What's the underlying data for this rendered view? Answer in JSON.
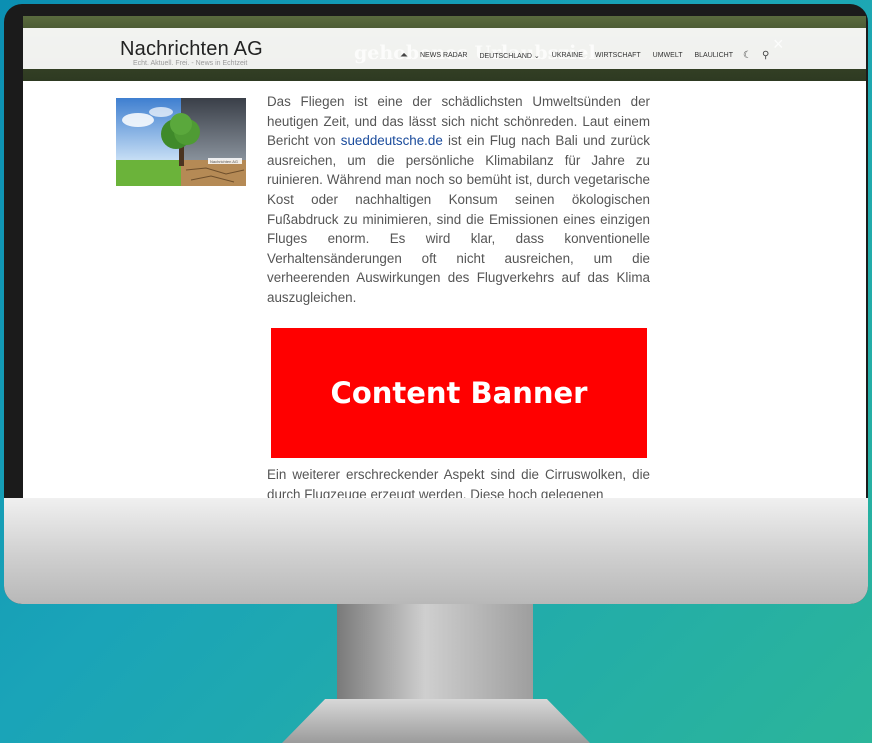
{
  "site": {
    "title": "Nachrichten AG",
    "tagline": "Echt. Aktuell. Frei. - News in Echtzeit",
    "hero_overlay": "gehobenes Urlaubsziel"
  },
  "nav": {
    "items": [
      "NEWS RADAR",
      "DEUTSCHLAND ⌄",
      "UKRAINE",
      "WIRTSCHAFT",
      "UMWELT",
      "BLAULICHT"
    ]
  },
  "thumbnail": {
    "caption": "Nachrichten AG"
  },
  "article": {
    "para1_before_link": "Das Fliegen ist eine der schädlichsten Umweltsünden der heutigen Zeit, und das lässt sich nicht schönreden. Laut einem Bericht von ",
    "link_text": "sueddeutsche.de",
    "para1_after_link": " ist ein Flug nach Bali und zurück ausreichen, um die persönliche Klimabilanz für Jahre zu ruinieren. Während man noch so bemüht ist, durch vegetarische Kost oder nachhaltigen Konsum seinen ökologischen Fußabdruck zu minimieren, sind die Emissionen eines einzigen Fluges enorm. Es wird klar, dass konventionelle Verhaltensänderungen oft nicht ausreichen, um die verheerenden Auswirkungen des Flugverkehrs auf das Klima auszugleichen.",
    "para2": "Ein weiterer erschreckender Aspekt sind die Cirruswolken, die durch Flugzeuge erzeugt werden. Diese hoch gelegenen"
  },
  "banner": {
    "label": "Content Banner",
    "color": "#ff0000"
  }
}
